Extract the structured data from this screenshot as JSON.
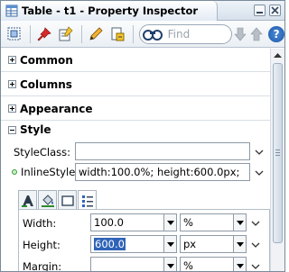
{
  "window": {
    "title": "Table - t1 - Property Inspector"
  },
  "toolbar": {
    "find_placeholder": "Find",
    "help_label": "?",
    "icons": [
      "refresh-icon",
      "pin-icon",
      "edit-icon",
      "pencil-icon",
      "bind-icon",
      "binoculars-icon",
      "arrow-down-icon",
      "arrow-up-icon",
      "help-icon"
    ]
  },
  "sections": {
    "common": "Common",
    "columns": "Columns",
    "appearance": "Appearance",
    "style": "Style"
  },
  "style": {
    "styleclass_label": "StyleClass:",
    "styleclass_value": "",
    "inlinestyle_label": "InlineStyle:",
    "inlinestyle_value": "width:100.0%; height:600.0px;"
  },
  "dimensions": {
    "width_label": "Width:",
    "width_value": "100.0",
    "width_unit": "%",
    "height_label": "Height:",
    "height_value": "600.0",
    "height_unit": "px",
    "margin_label": "Margin:",
    "margin_value": "",
    "margin_unit": "%"
  },
  "colors": {
    "accent": "#2f63b8",
    "modified_bullet": "#3a9a3a"
  }
}
